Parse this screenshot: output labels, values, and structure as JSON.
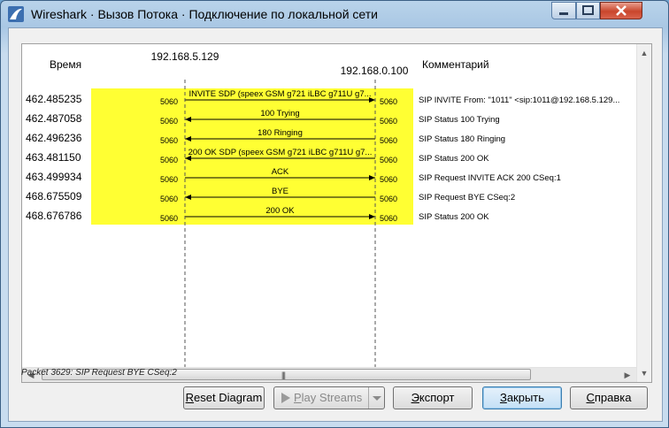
{
  "window": {
    "title": "Wireshark · Вызов Потока · Подключение по локальной сети"
  },
  "columns": {
    "time": "Время",
    "comment": "Комментарий",
    "host_a": "192.168.5.129",
    "host_b": "192.168.0.100"
  },
  "rows": [
    {
      "time": "462.485235",
      "label": "INVITE SDP (speex GSM g721 iLBC g711U g7...",
      "dir": "right",
      "port_a": "5060",
      "port_b": "5060",
      "comment": "SIP INVITE From: \"1011\" <sip:1011@192.168.5.129..."
    },
    {
      "time": "462.487058",
      "label": "100 Trying",
      "dir": "left",
      "port_a": "5060",
      "port_b": "5060",
      "comment": "SIP Status 100 Trying"
    },
    {
      "time": "462.496236",
      "label": "180 Ringing",
      "dir": "left",
      "port_a": "5060",
      "port_b": "5060",
      "comment": "SIP Status 180 Ringing"
    },
    {
      "time": "463.481150",
      "label": "200 OK SDP (speex GSM g721 iLBC g711U g7...",
      "dir": "left",
      "port_a": "5060",
      "port_b": "5060",
      "comment": "SIP Status 200 OK"
    },
    {
      "time": "463.499934",
      "label": "ACK",
      "dir": "right",
      "port_a": "5060",
      "port_b": "5060",
      "comment": "SIP Request INVITE ACK 200 CSeq:1"
    },
    {
      "time": "468.675509",
      "label": "BYE",
      "dir": "left",
      "port_a": "5060",
      "port_b": "5060",
      "comment": "SIP Request BYE CSeq:2"
    },
    {
      "time": "468.676786",
      "label": "200 OK",
      "dir": "right",
      "port_a": "5060",
      "port_b": "5060",
      "comment": "SIP Status 200 OK"
    }
  ],
  "status_text": "Packet 3629: SIP Request BYE CSeq:2",
  "buttons": {
    "reset": "Reset Diagram",
    "play": "Play Streams",
    "export": "Экспорт",
    "close": "Закрыть",
    "help": "Справка"
  },
  "colors": {
    "highlight": "#ffff33",
    "close_button": "#c9462c"
  },
  "icons": {
    "app": "wireshark-fin-icon",
    "play": "play-icon",
    "dropdown": "chevron-down-icon",
    "grip": "scroll-grip-icon"
  }
}
